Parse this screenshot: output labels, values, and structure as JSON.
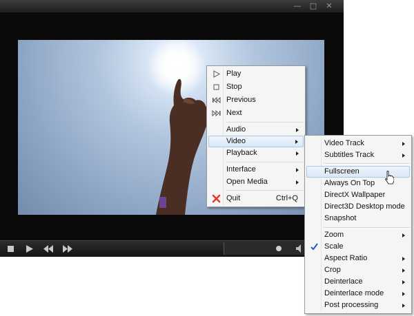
{
  "window": {
    "buttons": {
      "minimize": "—",
      "maximize": "□",
      "close": "✕"
    }
  },
  "controls": [
    "stop",
    "play",
    "previous",
    "next",
    "volume"
  ],
  "context_menu": {
    "items": [
      {
        "label": "Play",
        "icon": "play-icon"
      },
      {
        "label": "Stop",
        "icon": "stop-icon"
      },
      {
        "label": "Previous",
        "icon": "previous-icon"
      },
      {
        "label": "Next",
        "icon": "next-icon"
      },
      {
        "label": "Audio",
        "submenu": true
      },
      {
        "label": "Video",
        "submenu": true,
        "highlighted": true
      },
      {
        "label": "Playback",
        "submenu": true
      },
      {
        "label": "Interface",
        "submenu": true
      },
      {
        "label": "Open Media",
        "submenu": true
      },
      {
        "label": "Quit",
        "icon": "quit-icon",
        "shortcut": "Ctrl+Q"
      }
    ]
  },
  "video_submenu": {
    "items": [
      {
        "label": "Video Track",
        "submenu": true
      },
      {
        "label": "Subtitles Track",
        "submenu": true
      },
      {
        "label": "Fullscreen",
        "highlighted": true
      },
      {
        "label": "Always On Top"
      },
      {
        "label": "DirectX Wallpaper"
      },
      {
        "label": "Direct3D Desktop mode"
      },
      {
        "label": "Snapshot"
      },
      {
        "label": "Zoom",
        "submenu": true
      },
      {
        "label": "Scale",
        "checked": true
      },
      {
        "label": "Aspect Ratio",
        "submenu": true
      },
      {
        "label": "Crop",
        "submenu": true
      },
      {
        "label": "Deinterlace",
        "submenu": true
      },
      {
        "label": "Deinterlace mode",
        "submenu": true
      },
      {
        "label": "Post processing",
        "submenu": true
      }
    ]
  },
  "colors": {
    "quit_icon": "#e23a2c",
    "check": "#1b5fb8",
    "highlight": "#dbe8f7"
  }
}
